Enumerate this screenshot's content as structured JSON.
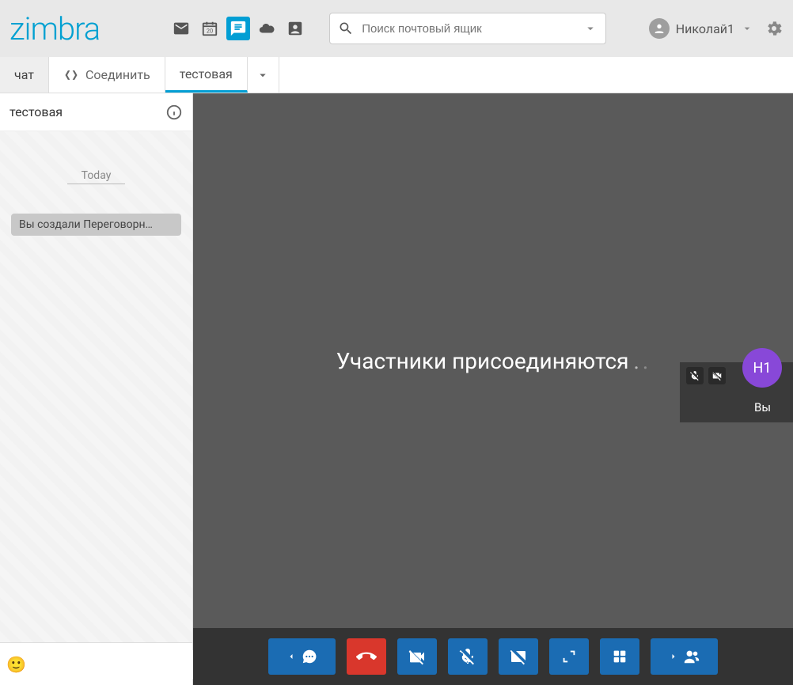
{
  "brand": "zimbra",
  "search": {
    "placeholder": "Поиск почтовый ящик"
  },
  "user": {
    "name": "Николай1"
  },
  "tabs": {
    "chat": "чат",
    "connect": "Соединить",
    "room": "тестовая"
  },
  "side": {
    "title": "тестовая",
    "day": "Today",
    "sysmsg": "Вы создали Переговорн…"
  },
  "meeting": {
    "text": "Участники присоединяются"
  },
  "self": {
    "initials": "Н1",
    "label": "Вы"
  }
}
